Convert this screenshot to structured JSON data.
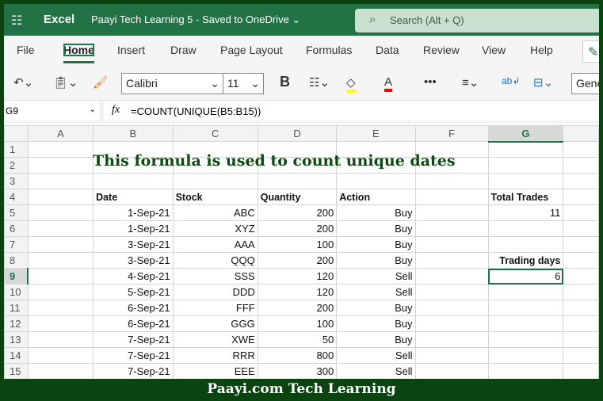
{
  "titlebar": {
    "app": "Excel",
    "document": "Paayi Tech Learning 5  -  Saved to OneDrive ⌄",
    "search_placeholder": "Search (Alt + Q)"
  },
  "tabs": [
    "File",
    "Home",
    "Insert",
    "Draw",
    "Page Layout",
    "Formulas",
    "Data",
    "Review",
    "View",
    "Help"
  ],
  "toolbar": {
    "font": "Calibri",
    "size": "11",
    "bold": "B",
    "number_format": "Gene",
    "more": "•••",
    "fill_color": "#ffff00",
    "font_color": "#ff0000"
  },
  "formula_bar": {
    "cell": "G9",
    "fx": "fx",
    "formula": "=COUNT(UNIQUE(B5:B15))"
  },
  "columns": [
    "A",
    "B",
    "C",
    "D",
    "E",
    "F",
    "G"
  ],
  "rows": [
    "1",
    "2",
    "3",
    "4",
    "5",
    "6",
    "7",
    "8",
    "9",
    "10",
    "11",
    "12",
    "13",
    "14",
    "15"
  ],
  "sheet_title": "This formula is used to count unique dates",
  "headers": {
    "date": "Date",
    "stock": "Stock",
    "quantity": "Quantity",
    "action": "Action"
  },
  "records": [
    [
      "1-Sep-21",
      "ABC",
      "200",
      "Buy"
    ],
    [
      "1-Sep-21",
      "XYZ",
      "200",
      "Buy"
    ],
    [
      "3-Sep-21",
      "AAA",
      "100",
      "Buy"
    ],
    [
      "3-Sep-21",
      "QQQ",
      "200",
      "Buy"
    ],
    [
      "4-Sep-21",
      "SSS",
      "120",
      "Sell"
    ],
    [
      "5-Sep-21",
      "DDD",
      "120",
      "Sell"
    ],
    [
      "6-Sep-21",
      "FFF",
      "200",
      "Buy"
    ],
    [
      "6-Sep-21",
      "GGG",
      "100",
      "Buy"
    ],
    [
      "7-Sep-21",
      "XWE",
      "50",
      "Buy"
    ],
    [
      "7-Sep-21",
      "RRR",
      "800",
      "Sell"
    ],
    [
      "7-Sep-21",
      "EEE",
      "300",
      "Sell"
    ]
  ],
  "summary": {
    "total_trades_label": "Total Trades",
    "total_trades": "11",
    "trading_days_label": "Trading days",
    "trading_days": "6"
  },
  "footer": "Paayi.com Tech Learning"
}
